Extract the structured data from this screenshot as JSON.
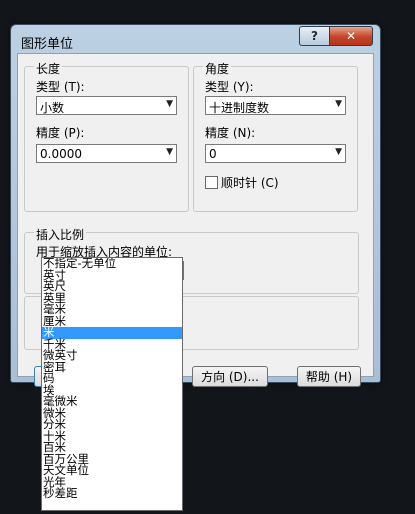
{
  "dialog": {
    "title": "图形单位",
    "help_button": "?",
    "close_button": "✕"
  },
  "length": {
    "group_label": "长度",
    "type_label": "类型 (T):",
    "type_value": "小数",
    "precision_label": "精度 (P):",
    "precision_value": "0.0000"
  },
  "angle": {
    "group_label": "角度",
    "type_label": "类型 (Y):",
    "type_value": "十进制度数",
    "precision_label": "精度 (N):",
    "precision_value": "0",
    "clockwise_label": "顺时针 (C)",
    "clockwise_checked": false
  },
  "insertion": {
    "group_label": "插入比例",
    "units_label": "用于缩放插入内容的单位:",
    "units_value": "米"
  },
  "buttons": {
    "direction": "方向 (D)...",
    "help": "帮助 (H)"
  },
  "dropdown": {
    "selected_index": 6,
    "options": [
      "不指定-无单位",
      "英寸",
      "英尺",
      "英里",
      "毫米",
      "厘米",
      "米",
      "千米",
      "微英寸",
      "密耳",
      "码",
      "埃",
      "毫微米",
      "微米",
      "分米",
      "十米",
      "百米",
      "百万公里",
      "天文单位",
      "光年",
      "秒差距"
    ]
  },
  "icons": {
    "combo_arrow": "chevron-down-icon"
  }
}
